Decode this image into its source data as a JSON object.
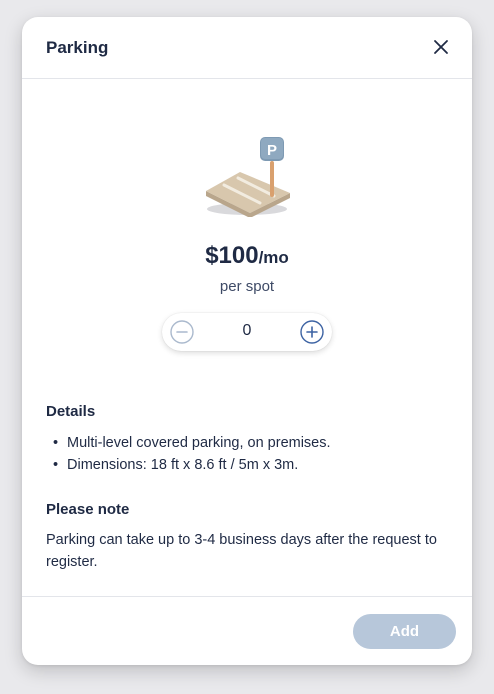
{
  "modal": {
    "title": "Parking"
  },
  "icons": {
    "close": "close-icon",
    "illustration": "parking-spot-illustration",
    "sign_letter": "P",
    "minus": "minus-circle-icon",
    "plus": "plus-circle-icon"
  },
  "pricing": {
    "amount": "$100",
    "unit": "/mo",
    "per": "per spot"
  },
  "stepper": {
    "value": "0"
  },
  "details": {
    "title": "Details",
    "items": [
      "Multi-level covered parking, on premises.",
      "Dimensions: 18 ft x 8.6 ft / 5m x 3m."
    ]
  },
  "note": {
    "title": "Please note",
    "text": "Parking can take up to 3-4 business days after the request to register."
  },
  "footer": {
    "add_label": "Add"
  },
  "colors": {
    "primary_text": "#1f2a44",
    "accent_blue": "#3d63a3",
    "disabled_button": "#b7c7da",
    "sign_blue": "#7e9ab3"
  }
}
